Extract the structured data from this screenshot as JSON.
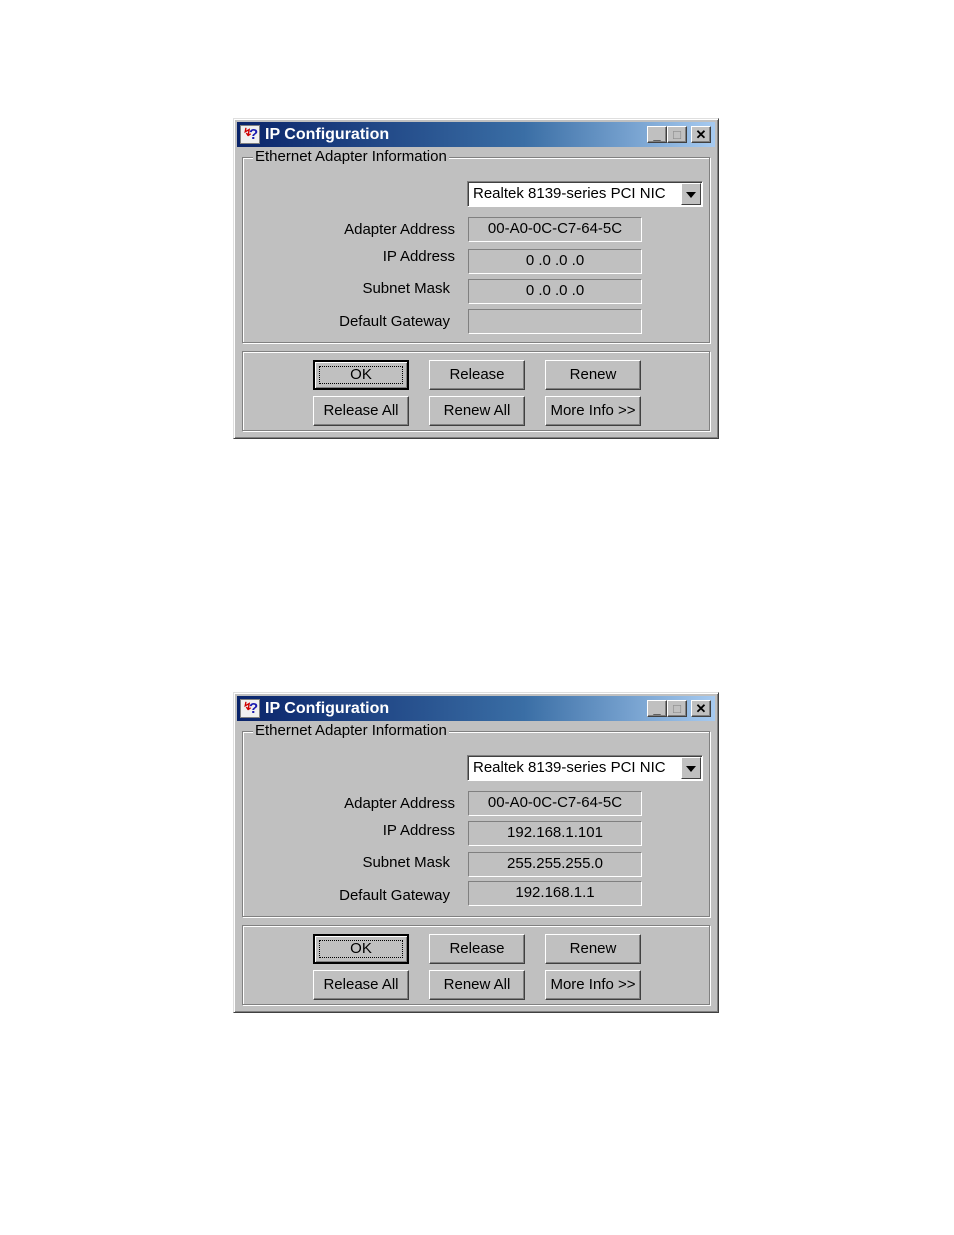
{
  "windows": [
    {
      "title": "IP Configuration",
      "title_icon": "winipcfg-help-icon",
      "caption_buttons": {
        "minimize": "_",
        "maximize": "□",
        "close": "✕"
      },
      "group_label": "Ethernet  Adapter Information",
      "adapter_select": {
        "selected": "Realtek 8139-series PCI NIC"
      },
      "fields": [
        {
          "label": "Adapter Address",
          "value": "00-A0-0C-C7-64-5C"
        },
        {
          "label": "IP Address",
          "value": "0 .0 .0 .0"
        },
        {
          "label": "Subnet Mask",
          "value": "0 .0 .0 .0"
        },
        {
          "label": "Default Gateway",
          "value": ""
        }
      ],
      "buttons": {
        "ok": "OK",
        "release": "Release",
        "renew": "Renew",
        "release_all": "Release All",
        "renew_all": "Renew All",
        "more_info": "More Info >>"
      }
    },
    {
      "title": "IP Configuration",
      "title_icon": "winipcfg-help-icon",
      "caption_buttons": {
        "minimize": "_",
        "maximize": "□",
        "close": "✕"
      },
      "group_label": "Ethernet  Adapter Information",
      "adapter_select": {
        "selected": "Realtek 8139-series PCI NIC"
      },
      "fields": [
        {
          "label": "Adapter Address",
          "value": "00-A0-0C-C7-64-5C"
        },
        {
          "label": "IP Address",
          "value": "192.168.1.101"
        },
        {
          "label": "Subnet Mask",
          "value": "255.255.255.0"
        },
        {
          "label": "Default Gateway",
          "value": "192.168.1.1"
        }
      ],
      "buttons": {
        "ok": "OK",
        "release": "Release",
        "renew": "Renew",
        "release_all": "Release All",
        "renew_all": "Renew All",
        "more_info": "More Info >>"
      }
    }
  ]
}
